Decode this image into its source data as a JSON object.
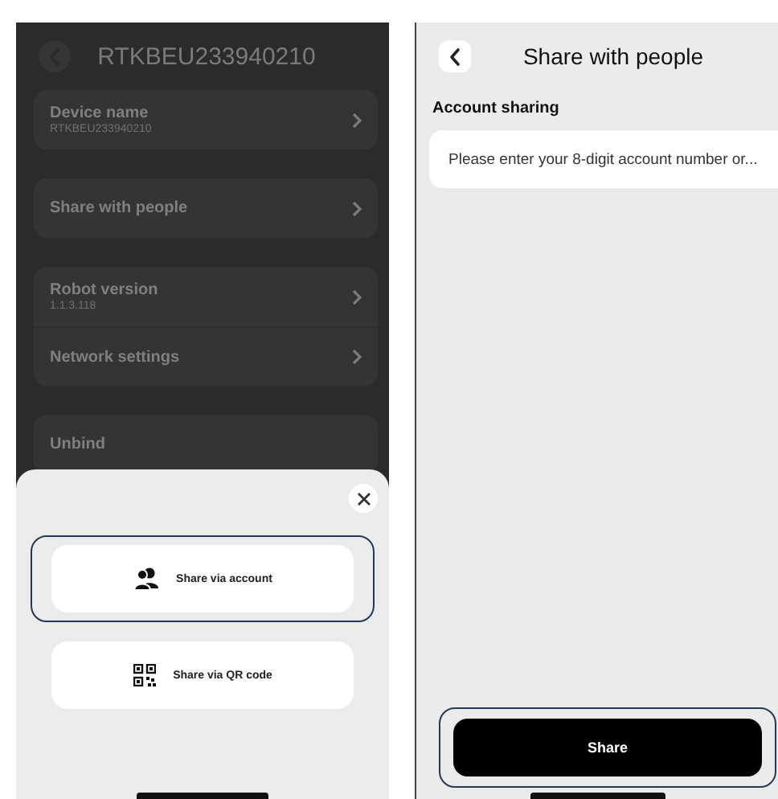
{
  "device_screen": {
    "title": "RTKBEU233940210",
    "groups": [
      {
        "items": [
          {
            "label": "Device name",
            "value": "RTKBEU233940210",
            "chevron": true
          }
        ]
      },
      {
        "items": [
          {
            "label": "Share with people",
            "chevron": true
          }
        ]
      },
      {
        "items": [
          {
            "label": "Robot version",
            "value": "1.1.3.118",
            "chevron": true
          },
          {
            "label": "Network settings",
            "chevron": true
          }
        ]
      },
      {
        "items": [
          {
            "label": "Unbind",
            "chevron": false
          }
        ]
      }
    ],
    "share_sheet": {
      "options": [
        {
          "kind": "account",
          "label": "Share via account",
          "highlighted": true
        },
        {
          "kind": "qr",
          "label": "Share via QR code",
          "highlighted": false
        }
      ]
    }
  },
  "share_screen": {
    "title": "Share with people",
    "section_label": "Account sharing",
    "account_field": {
      "placeholder": "Please enter your 8-digit account number or..."
    },
    "share_button": {
      "label": "Share",
      "highlighted": true
    }
  }
}
